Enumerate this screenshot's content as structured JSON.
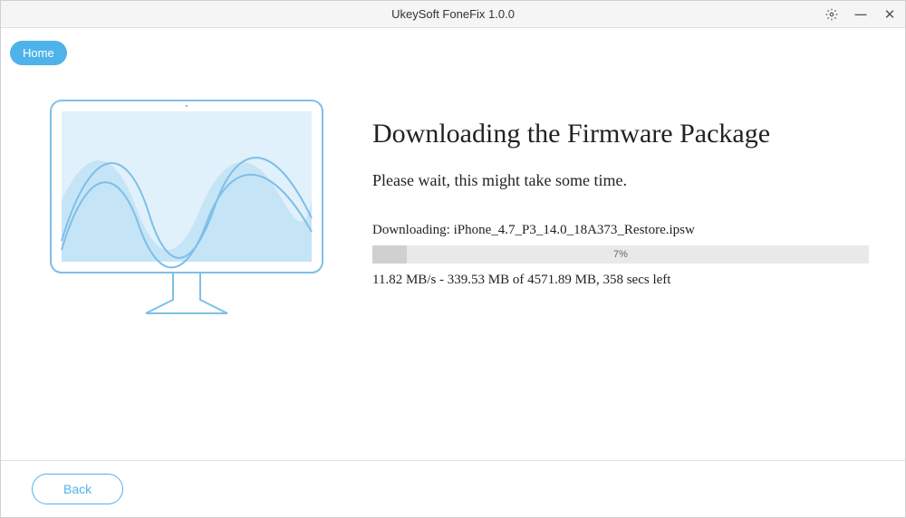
{
  "titlebar": {
    "title": "UkeySoft FoneFix 1.0.0"
  },
  "nav": {
    "home_label": "Home"
  },
  "main": {
    "heading": "Downloading the Firmware Package",
    "subheading": "Please wait, this might take some time.",
    "download_label": "Downloading: iPhone_4.7_P3_14.0_18A373_Restore.ipsw",
    "progress_percent": "7%",
    "stats": "11.82 MB/s - 339.53 MB of 4571.89 MB, 358 secs left"
  },
  "footer": {
    "back_label": "Back"
  },
  "colors": {
    "accent": "#4fb3eb"
  }
}
